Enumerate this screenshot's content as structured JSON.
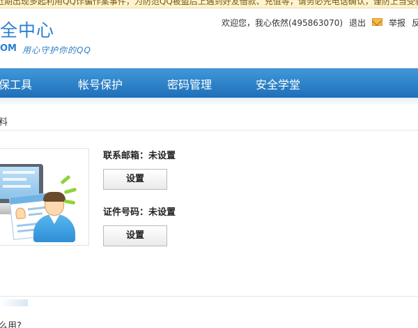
{
  "notice": {
    "text": "近期出现多起利用QQ诈骗作案事件，为防范QQ被盗后上遇到好友借款、充值等，请务必先电话确认，谨防上当受骗"
  },
  "header": {
    "logo_title": "全中心",
    "logo_domain": "OM",
    "logo_slogan": "用心守护你的QQ",
    "welcome": "欢迎您，我心依然(495863070)",
    "logout": "退出",
    "mail_icon": "mail-icon",
    "report": "举报",
    "feedback": "反"
  },
  "nav": {
    "items": [
      {
        "label": "保工具"
      },
      {
        "label": "帐号保护"
      },
      {
        "label": "密码管理"
      },
      {
        "label": "安全学堂"
      }
    ],
    "accent_color": "#2a7fd0"
  },
  "breadcrumb": {
    "text": "料"
  },
  "settings": {
    "email": {
      "label": "联系邮箱：未设置",
      "button": "设置"
    },
    "id": {
      "label": "证件号码：未设置",
      "button": "设置"
    }
  },
  "bottom": {
    "text": "么用?"
  }
}
